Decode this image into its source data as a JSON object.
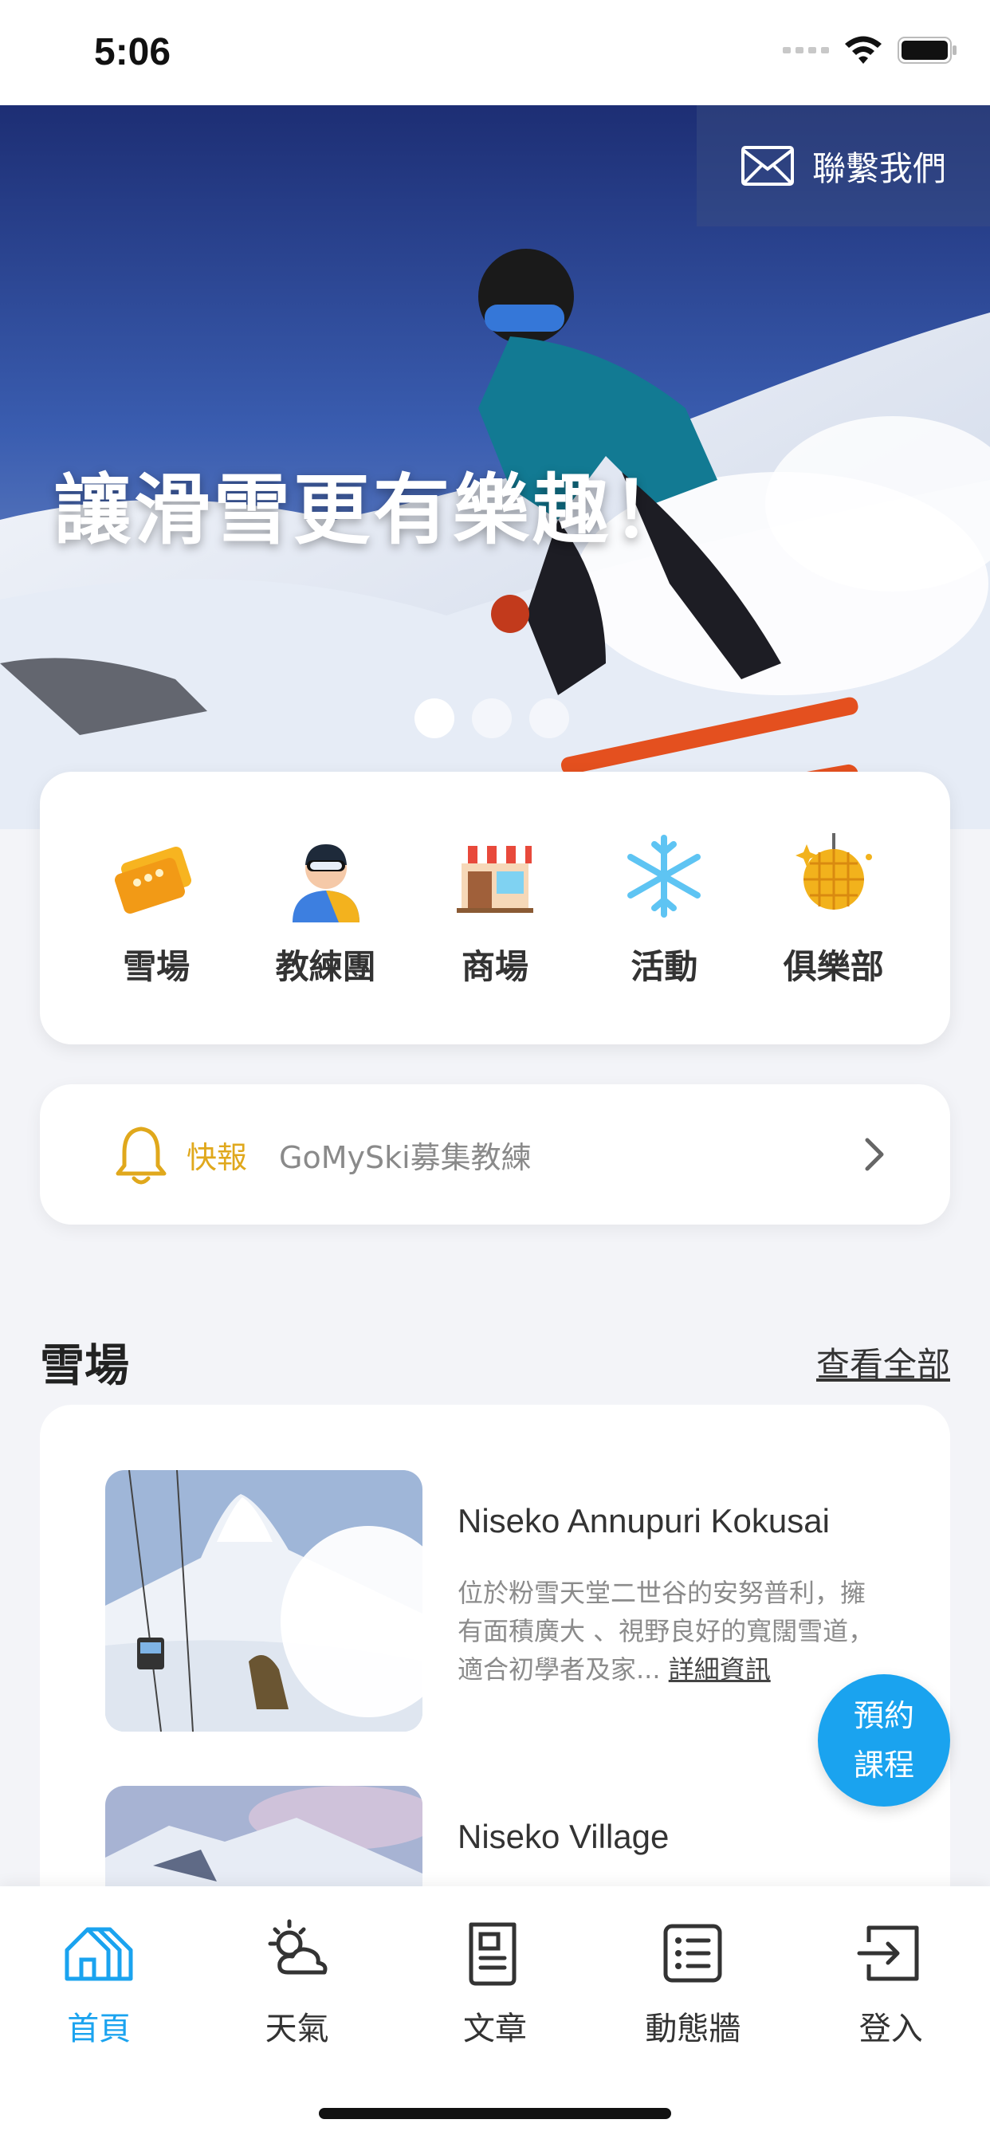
{
  "status_bar": {
    "time": "5:06"
  },
  "hero": {
    "title": "讓滑雪更有樂趣！",
    "contact_label": "聯繫我們",
    "slides_total": 3,
    "active_slide": 1
  },
  "categories": [
    {
      "label": "雪場",
      "icon": "ticket-icon"
    },
    {
      "label": "教練團",
      "icon": "coach-icon"
    },
    {
      "label": "商場",
      "icon": "store-icon"
    },
    {
      "label": "活動",
      "icon": "snowflake-icon"
    },
    {
      "label": "俱樂部",
      "icon": "disco-ball-icon"
    }
  ],
  "news": {
    "tag": "快報",
    "text": "GoMySki募集教練"
  },
  "resorts_section": {
    "title": "雪場",
    "more_label": "查看全部",
    "items": [
      {
        "name": "Niseko Annupuri Kokusai",
        "description": "位於粉雪天堂二世谷的安努普利，擁有面積廣大 、視野良好的寬闊雪道，適合初學者及家...",
        "link_label": "詳細資訊"
      },
      {
        "name": "Niseko Village",
        "description": "",
        "link_label": ""
      }
    ]
  },
  "fab": {
    "label": "預約課程"
  },
  "tabbar": {
    "items": [
      {
        "label": "首頁",
        "icon": "home-icon",
        "active": true
      },
      {
        "label": "天氣",
        "icon": "weather-icon",
        "active": false
      },
      {
        "label": "文章",
        "icon": "article-icon",
        "active": false
      },
      {
        "label": "動態牆",
        "icon": "feed-icon",
        "active": false
      },
      {
        "label": "登入",
        "icon": "login-icon",
        "active": false
      }
    ]
  },
  "colors": {
    "accent": "#1aa3ef",
    "news_tag": "#e0a81c",
    "background": "#f3f4f8"
  }
}
